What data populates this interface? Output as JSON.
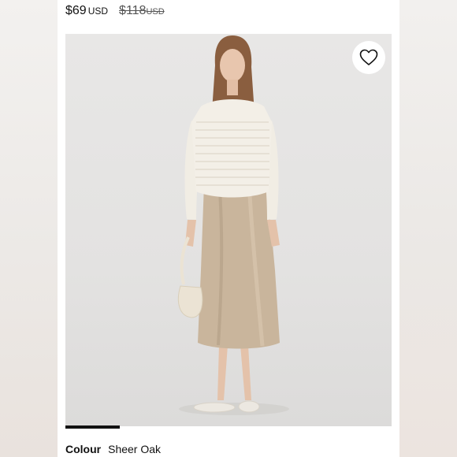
{
  "price": {
    "current": "$69",
    "current_unit": "USD",
    "original": "$118",
    "original_unit": "USD"
  },
  "product_image": {
    "favorite_icon": "heart-outline-icon",
    "carousel_progress": 0.17
  },
  "colour": {
    "label": "Colour",
    "value": "Sheer Oak"
  },
  "colors": {
    "text": "#111111",
    "image_bg": "#e4e3e2",
    "skirt": "#c9b59c",
    "sweater": "#f1ede4"
  }
}
